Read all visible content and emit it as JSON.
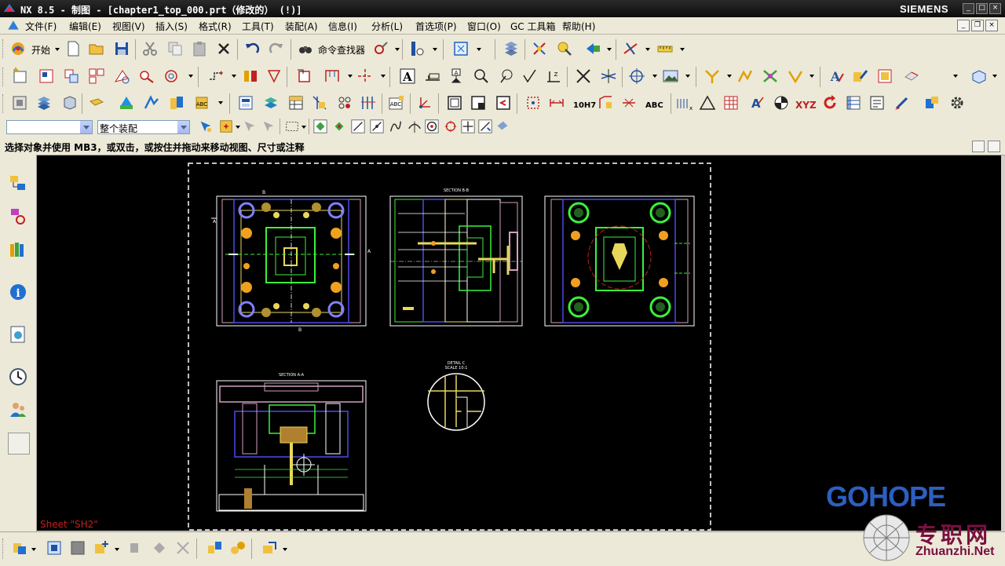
{
  "window": {
    "title": "NX 8.5 - 制图 - [chapter1_top_000.prt（修改的） (!)]",
    "brand": "SIEMENS"
  },
  "menu": [
    {
      "label": "文件(F)"
    },
    {
      "label": "编辑(E)"
    },
    {
      "label": "视图(V)"
    },
    {
      "label": "插入(S)"
    },
    {
      "label": "格式(R)"
    },
    {
      "label": "工具(T)"
    },
    {
      "label": "装配(A)"
    },
    {
      "label": "信息(I)"
    },
    {
      "label": "分析(L)"
    },
    {
      "label": "首选项(P)"
    },
    {
      "label": "窗口(O)"
    },
    {
      "label": "GC 工具箱"
    },
    {
      "label": "帮助(H)"
    }
  ],
  "toolbar": {
    "start_label": "开始",
    "command_finder_label": "命令查找器",
    "tolerance_label": "10H7",
    "abc_label": "ABC",
    "xyz_label": "XYZ"
  },
  "selection_bar": {
    "filter_value": "",
    "scope_value": "整个装配"
  },
  "cue_line": "选择对象并使用 MB3，或双击，或按住并拖动来移动视图、尺寸或注释",
  "drawing": {
    "sheet_label": "Sheet \"SH2\"",
    "views": [
      {
        "name": "top-view",
        "label": ""
      },
      {
        "name": "section-b-b",
        "label": "SECTION B-B"
      },
      {
        "name": "bottom-view",
        "label": ""
      },
      {
        "name": "section-a-a",
        "label": "SECTION A-A"
      },
      {
        "name": "detail-c",
        "label": "DETAIL C",
        "scale": "SCALE 10:1"
      }
    ],
    "marker_b": "B",
    "marker_a": "A"
  },
  "watermark": {
    "logo": "GOHOPE",
    "cn": "专职网",
    "url": "Zhuanzhi.Net"
  },
  "colors": {
    "canvas_bg": "#000000",
    "sheet_border": "#ffffff",
    "line_yellow": "#e8d85a",
    "line_green": "#3cf03c",
    "line_blue": "#4a4ae8",
    "line_orange": "#f0a020",
    "line_pink": "#d0a0c0"
  }
}
